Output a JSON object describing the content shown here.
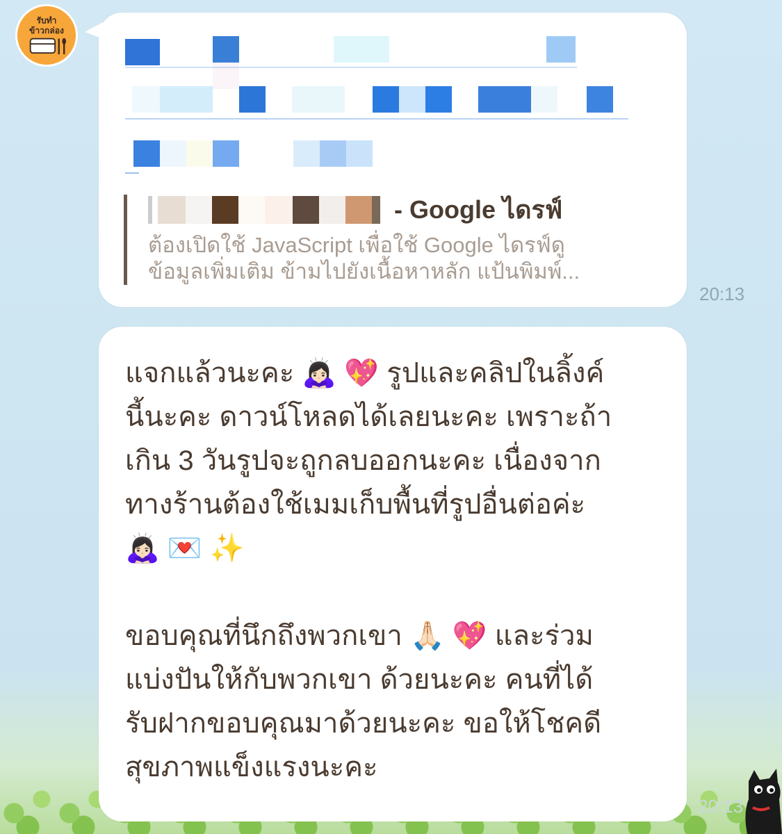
{
  "chat": {
    "background_color": "#cfe6f3",
    "sender_avatar_text": "รับทำ ข้าวกล่อง",
    "messages": [
      {
        "type": "link",
        "url_text_redacted": true,
        "preview_title": "- Google ไดรฟ์",
        "preview_description": "ต้องเปิดใช้ JavaScript เพื่อใช้ Google ไดรฟ์ดู\nข้อมูลเพิ่มเติม ข้ามไปยังเนื้อหาหลัก แป้นพิมพ์...",
        "time": "20:13"
      },
      {
        "type": "text",
        "text": "แจกแล้วนะคะ 🙇🏻‍♀️ 💖 รูปและคลิปในลิ้งค์\nนี้นะคะ ดาวน์โหลดได้เลยนะคะ เพราะถ้า\nเกิน 3 วันรูปจะถูกลบออกนะคะ เนื่องจาก\nทางร้านต้องใช้เมมเก็บพื้นที่รูปอื่นต่อค่ะ\n🙇🏻‍♀️ 💌 ✨\n\nขอบคุณที่นึกถึงพวกเขา 🙏🏻 💖 และร่วม\nแบ่งปันให้กับพวกเขา ด้วยนะคะ คนที่ได้\nรับฝากขอบคุณมาด้วยนะคะ ขอให้โชคดี\nสุขภาพแข็งแรงนะคะ",
        "time": "20:13"
      }
    ],
    "colors": {
      "bubble": "#ffffff",
      "message_text": "#4a3b30",
      "preview_desc": "#a89c92",
      "time": "#8fa6b3",
      "link": "#3b82e0"
    }
  }
}
